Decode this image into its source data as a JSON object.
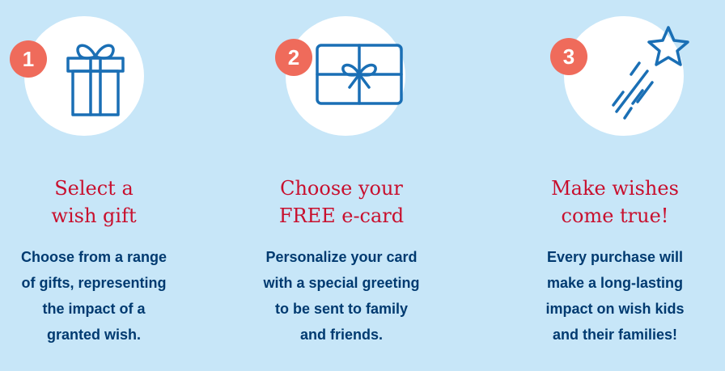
{
  "colors": {
    "background": "#c7e6f8",
    "circle": "#ffffff",
    "badge": "#ef6b5b",
    "title": "#c8102e",
    "description": "#003a70",
    "icon_stroke": "#1a6fb5"
  },
  "steps": [
    {
      "number": "1",
      "icon": "gift-box-icon",
      "title_lines": [
        "Select a",
        "wish gift"
      ],
      "desc_lines": [
        "Choose from a range",
        "of gifts, representing",
        "the impact of a",
        "granted wish."
      ]
    },
    {
      "number": "2",
      "icon": "gift-card-icon",
      "title_lines": [
        "Choose your",
        "FREE e-card"
      ],
      "desc_lines": [
        "Personalize your card",
        "with a special greeting",
        "to be sent to family",
        "and friends."
      ]
    },
    {
      "number": "3",
      "icon": "shooting-star-icon",
      "title_lines": [
        "Make wishes",
        "come true!"
      ],
      "desc_lines": [
        "Every purchase will",
        "make a long-lasting",
        "impact on wish kids",
        "and their families!"
      ]
    }
  ]
}
